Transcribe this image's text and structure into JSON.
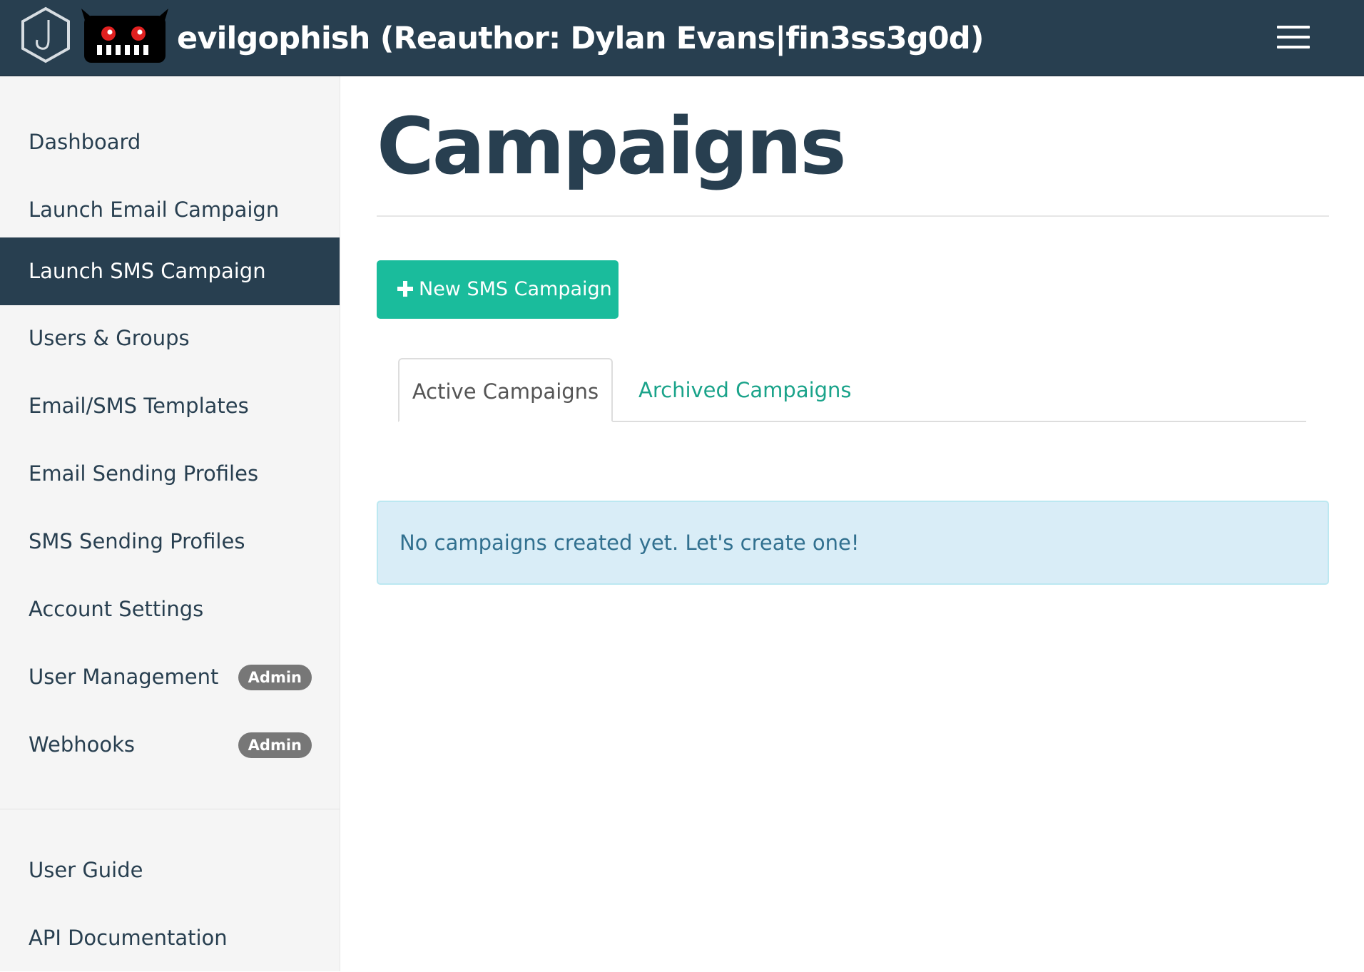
{
  "navbar": {
    "brand": "evilgophish (Reauthor: Dylan Evans|fin3ss3g0d)",
    "logo_icon": "gophish-hook-hexagon-icon",
    "mascot_icon": "evil-gopher-monster-icon",
    "menu_icon": "hamburger-menu-icon",
    "background": "#283f50"
  },
  "sidebar": {
    "items": [
      {
        "label": "Dashboard"
      },
      {
        "label": "Launch Email Campaign"
      },
      {
        "label": "Launch SMS Campaign",
        "active": true
      },
      {
        "label": "Users & Groups"
      },
      {
        "label": "Email/SMS Templates"
      },
      {
        "label": "Email Sending Profiles"
      },
      {
        "label": "SMS Sending Profiles"
      },
      {
        "label": "Account Settings"
      },
      {
        "label": "User Management",
        "badge": "Admin"
      },
      {
        "label": "Webhooks",
        "badge": "Admin"
      }
    ],
    "footer_items": [
      {
        "label": "User Guide"
      },
      {
        "label": "API Documentation"
      }
    ]
  },
  "main": {
    "title": "Campaigns",
    "new_button_label": "New SMS Campaign",
    "new_button_icon": "plus-icon",
    "tabs": [
      {
        "label": "Active Campaigns",
        "active": true
      },
      {
        "label": "Archived Campaigns",
        "active": false
      }
    ],
    "empty_message": "No campaigns created yet. Let's create one!"
  },
  "colors": {
    "accent": "#1abc9c",
    "dark": "#283f50",
    "alert_bg": "#d9edf7",
    "alert_text": "#31708f",
    "badge": "#777777"
  }
}
